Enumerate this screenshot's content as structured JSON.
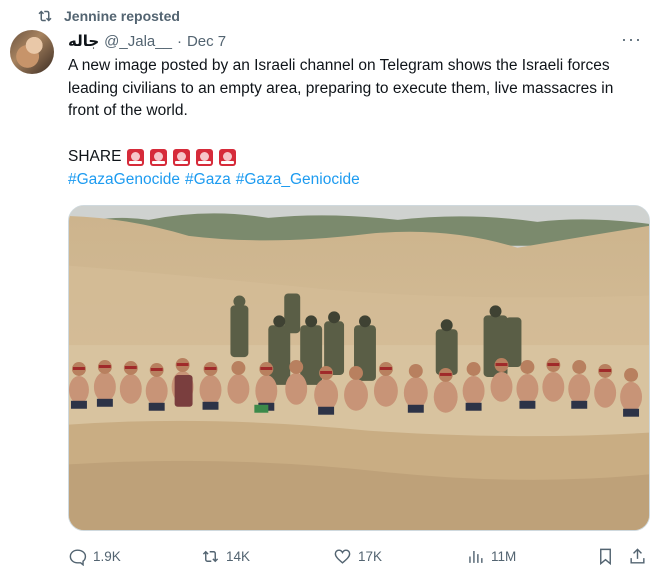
{
  "repost": {
    "label": "Jennine reposted"
  },
  "author": {
    "display_name": "جاله",
    "handle": "@_Jala__",
    "separator": "·",
    "date": "Dec 7"
  },
  "tweet": {
    "text": "A new image posted by an Israeli channel on Telegram shows the Israeli forces leading civilians to an empty area, preparing to execute them, live massacres in front of the world.",
    "share_word": "SHARE",
    "hashtags": [
      "#GazaGenocide",
      "#Gaza",
      "#Gaza_Geniocide"
    ]
  },
  "more_menu": {
    "label": "···"
  },
  "stats": {
    "replies": "1.9K",
    "reposts": "14K",
    "likes": "17K",
    "views": "11M"
  },
  "colors": {
    "link": "#1d9bf0",
    "muted": "#536471",
    "text": "#0f1419"
  },
  "icons": {
    "repost": "repost-icon",
    "reply": "reply-icon",
    "like": "heart-icon",
    "views": "bar-chart-icon",
    "bookmark": "bookmark-icon",
    "share": "share-icon",
    "siren": "police-light-icon"
  }
}
